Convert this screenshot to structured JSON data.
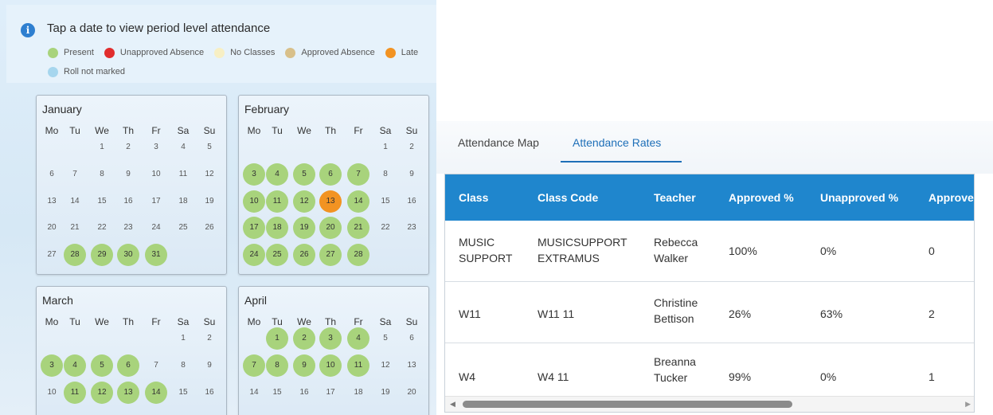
{
  "legend": {
    "title": "Tap a date to view period level attendance",
    "items": [
      {
        "label": "Present",
        "color": "#a8d37c"
      },
      {
        "label": "Unapproved Absence",
        "color": "#e12d2d"
      },
      {
        "label": "No Classes",
        "color": "#f7efc4"
      },
      {
        "label": "Approved Absence",
        "color": "#d8c08a"
      },
      {
        "label": "Late",
        "color": "#f29322"
      },
      {
        "label": "Roll not marked",
        "color": "#a6d6ee"
      }
    ]
  },
  "weekdays": [
    "Mo",
    "Tu",
    "We",
    "Th",
    "Fr",
    "Sa",
    "Su"
  ],
  "months": [
    {
      "name": "January",
      "days": [
        [
          null,
          null,
          "1",
          "2",
          "3",
          "4",
          "5"
        ],
        [
          "6",
          "7",
          "8",
          "9",
          "10",
          "11",
          "12"
        ],
        [
          "13",
          "14",
          "15",
          "16",
          "17",
          "18",
          "19"
        ],
        [
          "20",
          "21",
          "22",
          "23",
          "24",
          "25",
          "26"
        ],
        [
          "27",
          "28",
          "29",
          "30",
          "31",
          null,
          null
        ]
      ],
      "present": [
        "28",
        "29",
        "30",
        "31"
      ],
      "late": []
    },
    {
      "name": "February",
      "days": [
        [
          null,
          null,
          null,
          null,
          null,
          "1",
          "2"
        ],
        [
          "3",
          "4",
          "5",
          "6",
          "7",
          "8",
          "9"
        ],
        [
          "10",
          "11",
          "12",
          "13",
          "14",
          "15",
          "16"
        ],
        [
          "17",
          "18",
          "19",
          "20",
          "21",
          "22",
          "23"
        ],
        [
          "24",
          "25",
          "26",
          "27",
          "28",
          null,
          null
        ]
      ],
      "present": [
        "3",
        "4",
        "5",
        "6",
        "7",
        "10",
        "11",
        "12",
        "14",
        "17",
        "18",
        "19",
        "20",
        "21",
        "24",
        "25",
        "26",
        "27",
        "28"
      ],
      "late": [
        "13"
      ]
    },
    {
      "name": "March",
      "days": [
        [
          null,
          null,
          null,
          null,
          null,
          "1",
          "2"
        ],
        [
          "3",
          "4",
          "5",
          "6",
          "7",
          "8",
          "9"
        ],
        [
          "10",
          "11",
          "12",
          "13",
          "14",
          "15",
          "16"
        ]
      ],
      "present": [
        "3",
        "4",
        "5",
        "6",
        "11",
        "12",
        "13",
        "14"
      ],
      "late": []
    },
    {
      "name": "April",
      "days": [
        [
          null,
          "1",
          "2",
          "3",
          "4",
          "5",
          "6"
        ],
        [
          "7",
          "8",
          "9",
          "10",
          "11",
          "12",
          "13"
        ],
        [
          "14",
          "15",
          "16",
          "17",
          "18",
          "19",
          "20"
        ]
      ],
      "present": [
        "1",
        "2",
        "3",
        "4",
        "7",
        "8",
        "9",
        "10",
        "11"
      ],
      "late": []
    }
  ],
  "tabs": [
    {
      "label": "Attendance Map"
    },
    {
      "label": "Attendance Rates",
      "active": true
    }
  ],
  "table": {
    "headers": [
      "Class",
      "Class Code",
      "Teacher",
      "Approved %",
      "Unapproved %",
      "Approve"
    ],
    "rows": [
      {
        "class": "MUSIC SUPPORT",
        "code": "MUSICSUPPORT EXTRAMUS",
        "teacher": "Rebecca Walker",
        "approved": "100%",
        "unapproved": "0%",
        "approve_count": "0"
      },
      {
        "class": "W11",
        "code": "W11 11",
        "teacher": "Christine Bettison",
        "approved": "26%",
        "unapproved": "63%",
        "approve_count": "2"
      },
      {
        "class": "W4",
        "code": "W4 11",
        "teacher": "Breanna Tucker",
        "approved": "99%",
        "unapproved": "0%",
        "approve_count": "1"
      }
    ]
  },
  "scrollbar": {
    "left_arrow": "◀",
    "right_arrow": "▶"
  },
  "icons": {
    "info": "i"
  }
}
